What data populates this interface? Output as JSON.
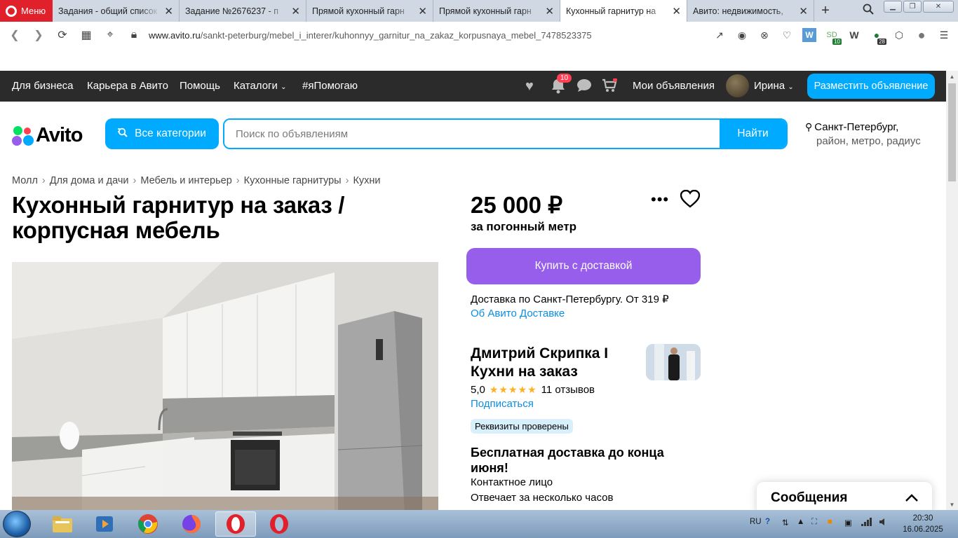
{
  "browser": {
    "menu_label": "Меню",
    "tabs": [
      {
        "title": "Задания - общий список",
        "icon": "sp-icon"
      },
      {
        "title": "Задание №2676237 - п",
        "icon": "sp-icon"
      },
      {
        "title": "Прямой кухонный гарн",
        "icon": "avito-icon"
      },
      {
        "title": "Прямой кухонный гарн",
        "icon": "avito-icon"
      },
      {
        "title": "Кухонный гарнитур на",
        "icon": "avito-icon",
        "active": true
      },
      {
        "title": "Авито: недвижимость,",
        "icon": "avito-icon"
      }
    ],
    "url_domain": "www.avito.ru",
    "url_path": "/sankt-peterburg/mebel_i_interer/kuhonnyy_garnitur_na_zakaz_korpusnaya_mebel_7478523375",
    "ext_badge_1": "10",
    "ext_badge_2": "28"
  },
  "topbar": {
    "business": "Для бизнеса",
    "career": "Карьера в Авито",
    "help": "Помощь",
    "catalogs": "Каталоги",
    "ihelp": "#яПомогаю",
    "notifications_count": "10",
    "my_ads": "Мои объявления",
    "user_name": "Ирина",
    "post_ad": "Разместить объявление"
  },
  "header": {
    "logo_text": "Avito",
    "all_categories": "Все категории",
    "search_placeholder": "Поиск по объявлениям",
    "search_button": "Найти",
    "city": "Санкт-Петербург,",
    "city_sub": "район, метро, радиус"
  },
  "breadcrumbs": [
    "Молл",
    "Для дома и дачи",
    "Мебель и интерьер",
    "Кухонные гарнитуры",
    "Кухни"
  ],
  "listing": {
    "title": "Кухонный гарнитур на заказ / корпусная мебель",
    "price": "25 000 ₽",
    "price_unit": "за погонный метр",
    "buy_button": "Купить с доставкой",
    "delivery": "Доставка по Санкт-Петербургу. От 319 ₽",
    "about_delivery": "Об Авито Доставке"
  },
  "seller": {
    "name": "Дмитрий Скрипка I Кухни на заказ",
    "rating": "5,0",
    "stars": "★★★★★",
    "reviews": "11 отзывов",
    "subscribe": "Подписаться",
    "verified": "Реквизиты проверены",
    "promo": "Бесплатная доставка до конца июня!",
    "contact": "Контактное лицо",
    "responds": "Отвечает за несколько часов"
  },
  "messages": {
    "label": "Сообщения"
  },
  "taskbar": {
    "lang": "RU",
    "time": "20:30",
    "date": "16.06.2025"
  }
}
